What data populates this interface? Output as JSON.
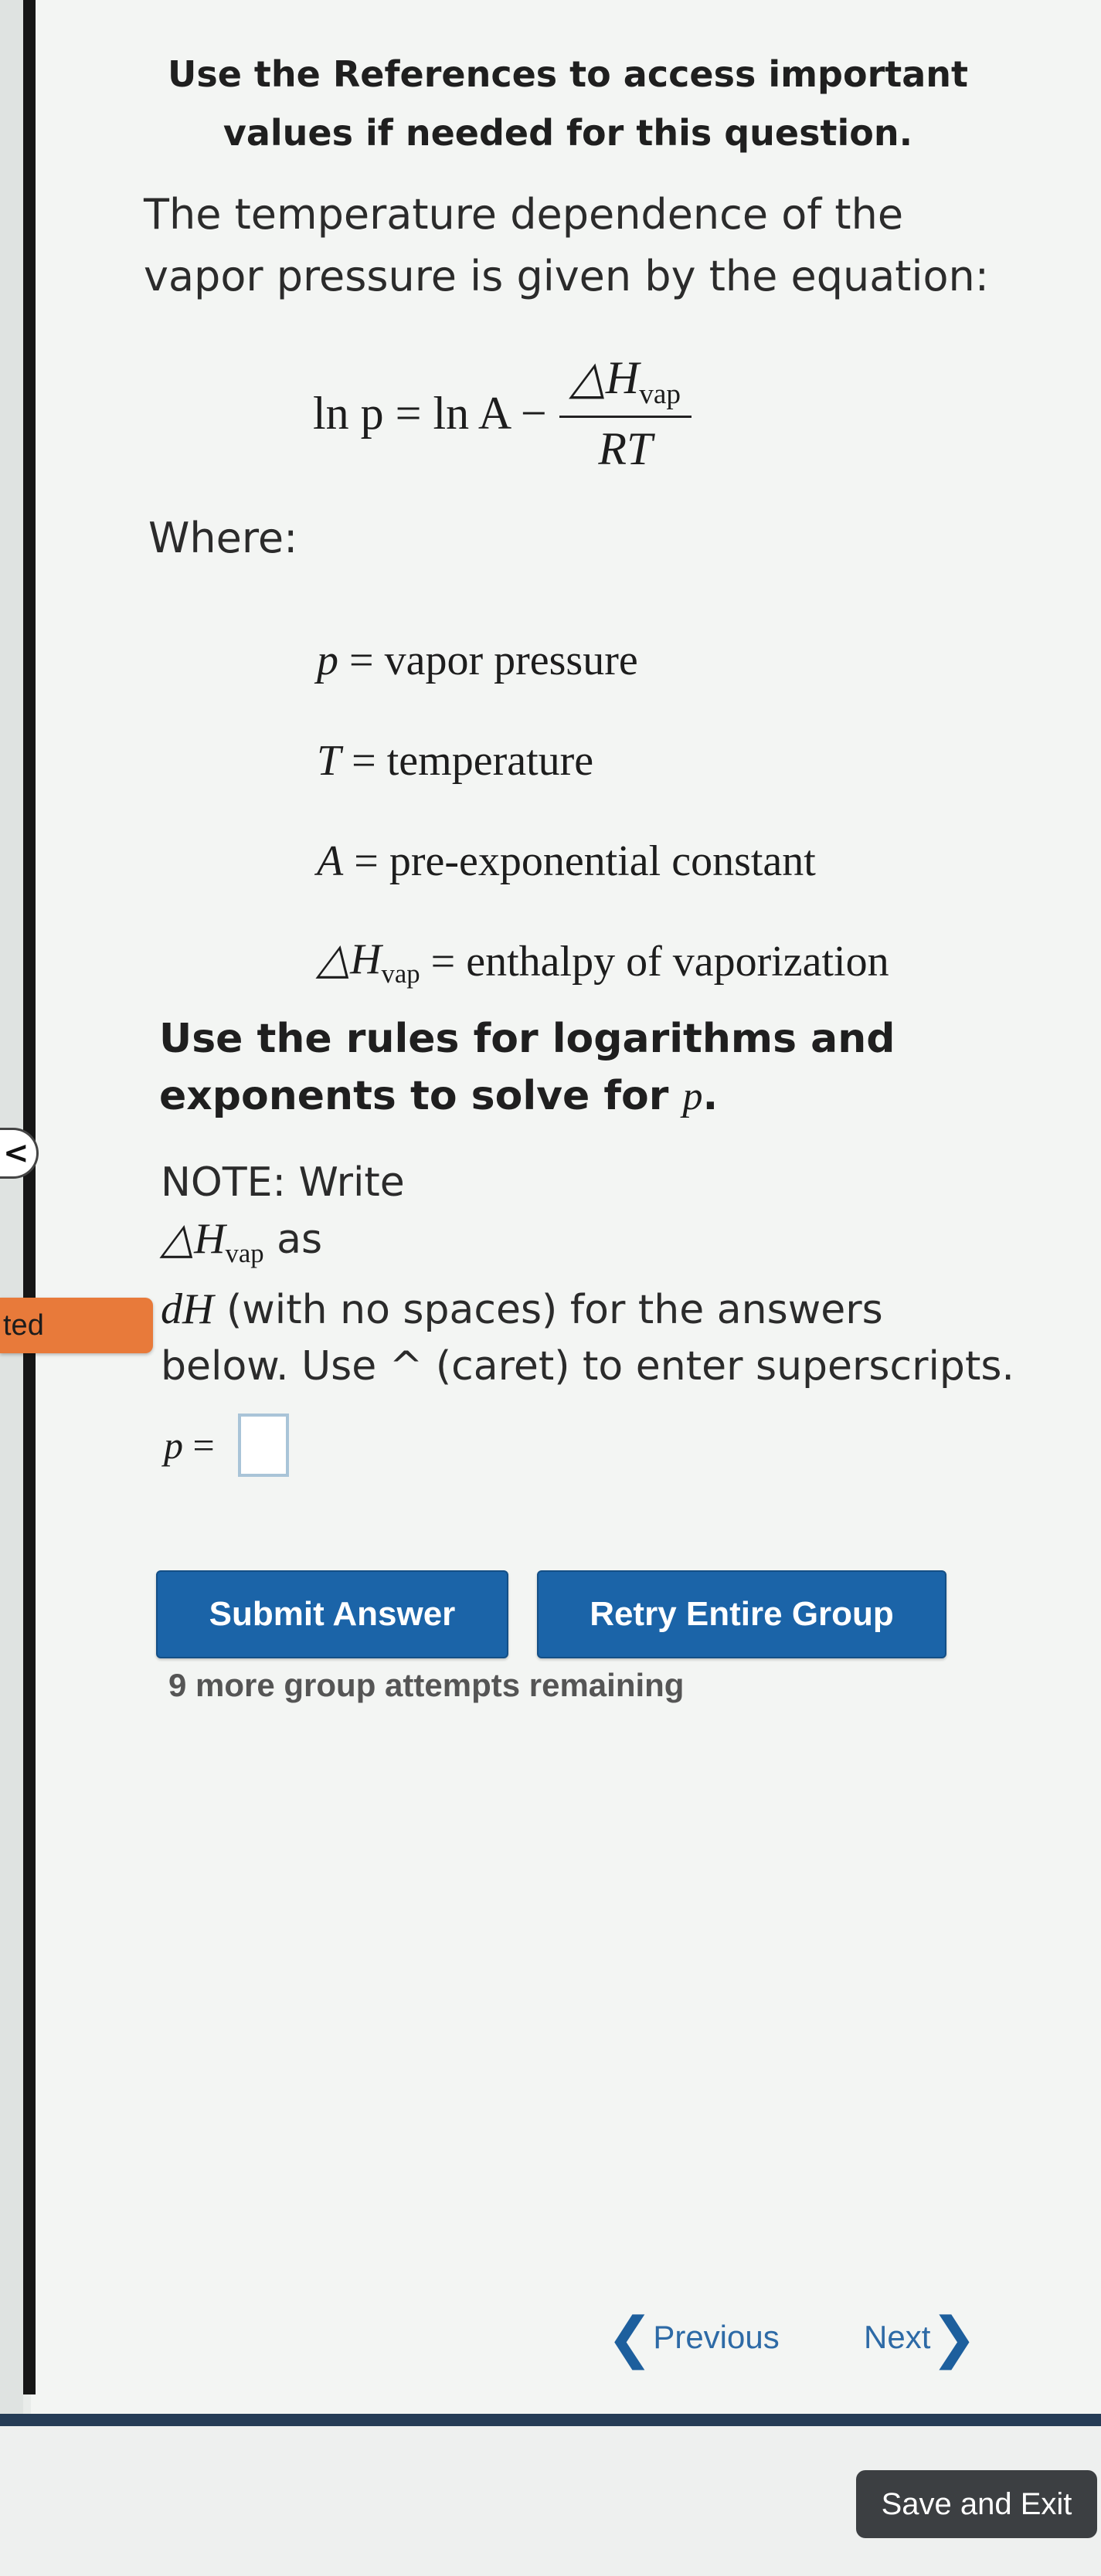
{
  "header": {
    "references_note": "Use the References to access important values if needed for this question."
  },
  "question": {
    "intro": "The temperature dependence of the vapor pressure is given by the equation:",
    "equation": {
      "lhs": "ln p",
      "rhs_prefix": "ln A −",
      "numerator_symbol": "△H",
      "numerator_sub": "vap",
      "denominator": "RT"
    },
    "where_label": "Where:",
    "definitions": [
      {
        "symbol": "p",
        "sub": "",
        "meaning": "vapor pressure"
      },
      {
        "symbol": "T",
        "sub": "",
        "meaning": "temperature"
      },
      {
        "symbol": "A",
        "sub": "",
        "meaning": "pre-exponential constant"
      },
      {
        "symbol": "△H",
        "sub": "vap",
        "meaning": "enthalpy of vaporization"
      }
    ],
    "instruction_text": "Use the rules for logarithms and exponents to solve for",
    "instruction_var": "p",
    "note": {
      "line1": "NOTE: Write",
      "symbol": "△H",
      "sub": "vap",
      "as_word": " as",
      "dh_symbol": "dH",
      "line3_rest": " (with no spaces) for the answers",
      "line4": "below. Use ^ (caret) to enter superscripts."
    },
    "answer": {
      "label_var": "p",
      "label_eq": " =",
      "value": ""
    }
  },
  "buttons": {
    "submit": "Submit Answer",
    "retry": "Retry Entire Group"
  },
  "attempts_text": "9 more group attempts remaining",
  "navigation": {
    "previous": "Previous",
    "next": "Next"
  },
  "sidebar": {
    "back_glyph": "<",
    "tab_label": "ted"
  },
  "footer": {
    "save_exit": "Save and Exit"
  },
  "colors": {
    "primary_button": "#1b64a8",
    "link": "#2d6aa6",
    "tab_orange": "#e87a3a",
    "footer_bar": "#253c56"
  },
  "icons": {
    "previous": "chevron-left-icon",
    "next": "chevron-right-icon"
  }
}
